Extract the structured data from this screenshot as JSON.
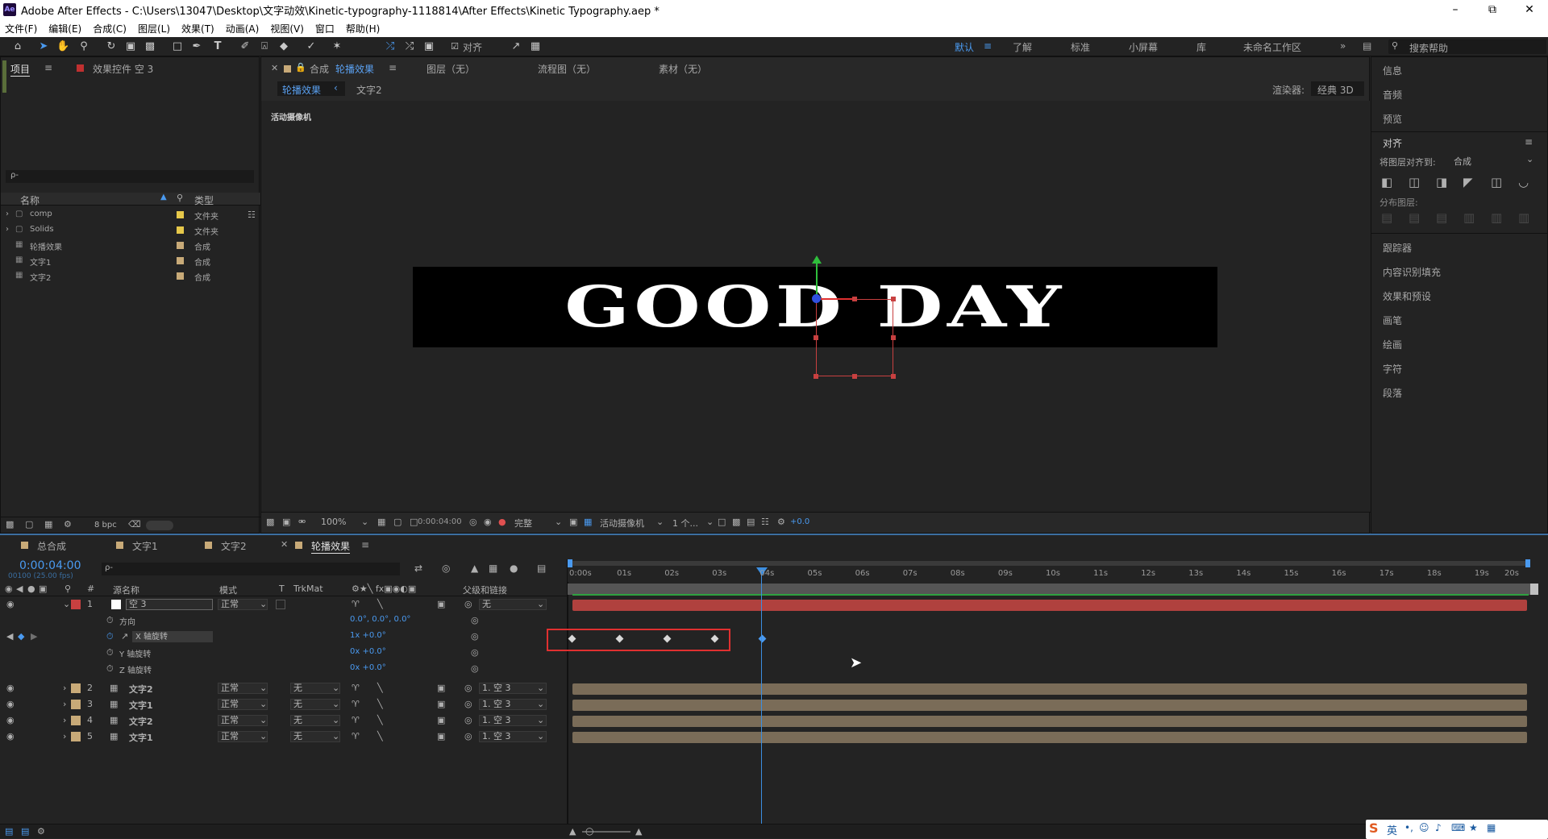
{
  "window": {
    "app_logo": "Ae",
    "title": "Adobe After Effects - C:\\Users\\13047\\Desktop\\文字动效\\Kinetic-typography-1118814\\After Effects\\Kinetic Typography.aep *"
  },
  "menu": [
    "文件(F)",
    "编辑(E)",
    "合成(C)",
    "图层(L)",
    "效果(T)",
    "动画(A)",
    "视图(V)",
    "窗口",
    "帮助(H)"
  ],
  "toolbar": {
    "snap_label": "对齐",
    "workspaces": [
      "默认",
      "了解",
      "标准",
      "小屏幕",
      "库",
      "未命名工作区"
    ],
    "search_placeholder": "搜索帮助"
  },
  "project_panel": {
    "tab_project": "项目",
    "tab_effects": "效果控件 空 3",
    "search_prefix": "ρ-",
    "col_name": "名称",
    "col_type": "类型",
    "items": [
      {
        "name": "comp",
        "type": "文件夹"
      },
      {
        "name": "Solids",
        "type": "文件夹"
      },
      {
        "name": "轮播效果",
        "type": "合成"
      },
      {
        "name": "文字1",
        "type": "合成"
      },
      {
        "name": "文字2",
        "type": "合成"
      }
    ],
    "bpc": "8 bpc"
  },
  "viewer": {
    "tab_comp_prefix": "合成",
    "tab_comp": "轮播效果",
    "tab_layer": "图层（无）",
    "tab_flow": "流程图（无）",
    "tab_footage": "素材（无）",
    "breadcrumb": [
      "轮播效果",
      "文字2"
    ],
    "renderer_label": "渲染器:",
    "renderer_value": "经典 3D",
    "camera_label": "活动摄像机",
    "canvas_text": "GOOD DAY",
    "footer": {
      "zoom": "100%",
      "timecode": "0:00:04:00",
      "quality": "完整",
      "camera": "活动摄像机",
      "views": "1 个...",
      "exposure": "+0.0"
    }
  },
  "right_panel": {
    "items_top": [
      "信息",
      "音频",
      "预览"
    ],
    "align_title": "对齐",
    "align_to_label": "将图层对齐到:",
    "align_to_value": "合成",
    "distribute_label": "分布图层:",
    "items_bottom": [
      "跟踪器",
      "内容识别填充",
      "效果和预设",
      "画笔",
      "绘画",
      "字符",
      "段落"
    ]
  },
  "timeline": {
    "tabs": [
      "总合成",
      "文字1",
      "文字2",
      "轮播效果"
    ],
    "timecode": "0:00:04:00",
    "timecode_sub": "00100 (25.00 fps)",
    "search_prefix": "ρ-",
    "headers": {
      "num": "#",
      "source": "源名称",
      "mode": "模式",
      "t": "T",
      "trkmat": "TrkMat",
      "parent": "父级和链接"
    },
    "layer1": {
      "num": "1",
      "name": "空 3",
      "mode": "正常",
      "parent": "无"
    },
    "props": [
      {
        "name": "方向",
        "value": "0.0°, 0.0°, 0.0°"
      },
      {
        "name": "X 轴旋转",
        "value": "1x +0.0°"
      },
      {
        "name": "Y 轴旋转",
        "value": "0x +0.0°"
      },
      {
        "name": "Z 轴旋转",
        "value": "0x +0.0°"
      }
    ],
    "layers": [
      {
        "num": "2",
        "name": "文字2",
        "mode": "正常",
        "trkmat": "无",
        "parent": "1. 空 3"
      },
      {
        "num": "3",
        "name": "文字1",
        "mode": "正常",
        "trkmat": "无",
        "parent": "1. 空 3"
      },
      {
        "num": "4",
        "name": "文字2",
        "mode": "正常",
        "trkmat": "无",
        "parent": "1. 空 3"
      },
      {
        "num": "5",
        "name": "文字1",
        "mode": "正常",
        "trkmat": "无",
        "parent": "1. 空 3"
      }
    ],
    "ruler": [
      "0:00s",
      "01s",
      "02s",
      "03s",
      "04s",
      "05s",
      "06s",
      "07s",
      "08s",
      "09s",
      "10s",
      "11s",
      "12s",
      "13s",
      "14s",
      "15s",
      "16s",
      "17s",
      "18s",
      "19s",
      "20s"
    ]
  },
  "colors": {
    "accent": "#3c8ee0",
    "layer_null": "#b0413e",
    "layer_comp": "#7a6c58",
    "highlight": "#e03030"
  },
  "taskbar": {
    "ime": "英"
  }
}
